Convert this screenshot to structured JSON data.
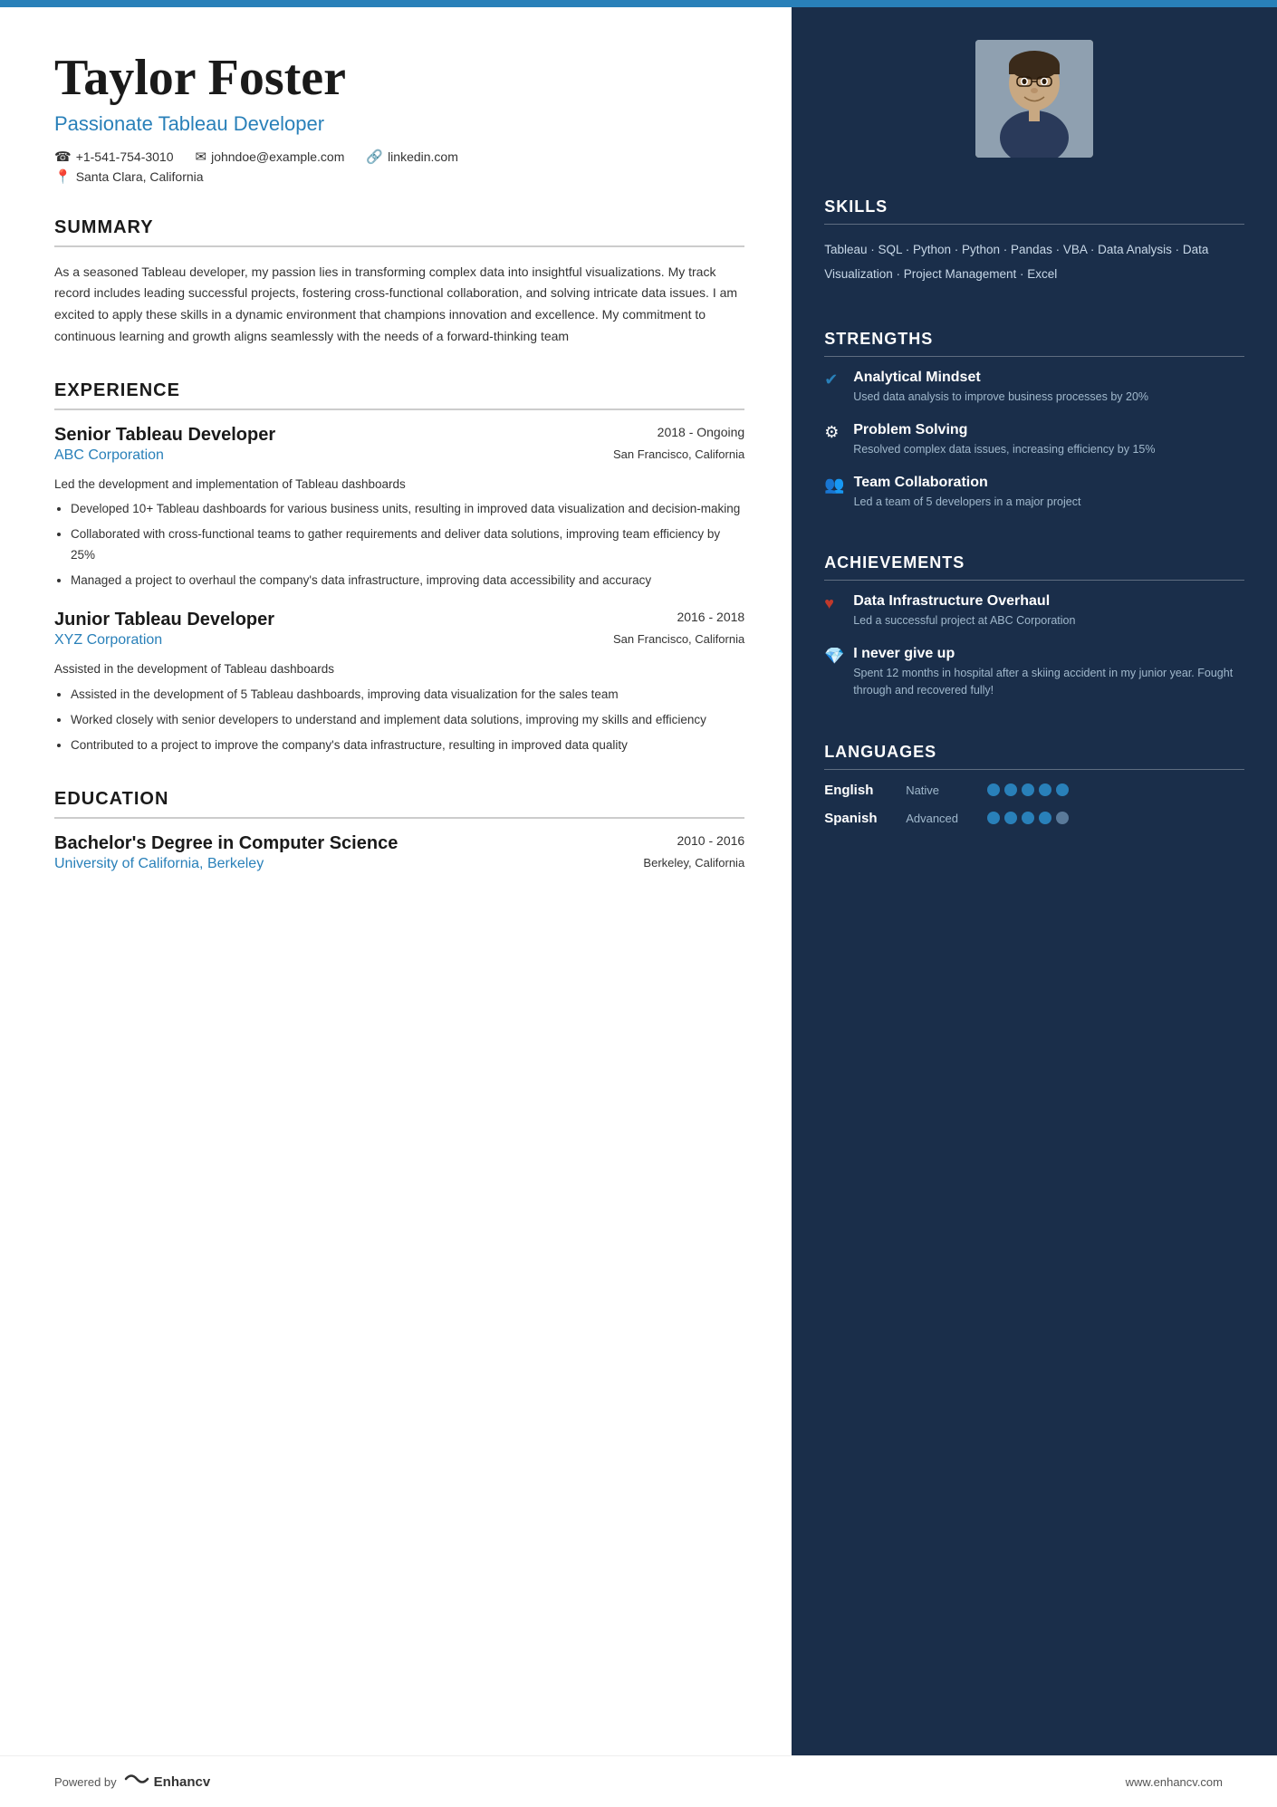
{
  "topbar": {
    "color": "#2980b9"
  },
  "header": {
    "name": "Taylor Foster",
    "title": "Passionate Tableau Developer",
    "phone": "+1-541-754-3010",
    "email": "johndoe@example.com",
    "linkedin": "linkedin.com",
    "location": "Santa Clara, California",
    "phone_icon": "☎",
    "email_icon": "✉",
    "linkedin_icon": "🔗",
    "location_icon": "📍"
  },
  "summary": {
    "title": "SUMMARY",
    "text": "As a seasoned Tableau developer, my passion lies in transforming complex data into insightful visualizations. My track record includes leading successful projects, fostering cross-functional collaboration, and solving intricate data issues. I am excited to apply these skills in a dynamic environment that champions innovation and excellence. My commitment to continuous learning and growth aligns seamlessly with the needs of a forward-thinking team"
  },
  "experience": {
    "title": "EXPERIENCE",
    "entries": [
      {
        "title": "Senior Tableau Developer",
        "company": "ABC Corporation",
        "dates": "2018 - Ongoing",
        "location": "San Francisco, California",
        "description": "Led the development and implementation of Tableau dashboards",
        "bullets": [
          "Developed 10+ Tableau dashboards for various business units, resulting in improved data visualization and decision-making",
          "Collaborated with cross-functional teams to gather requirements and deliver data solutions, improving team efficiency by 25%",
          "Managed a project to overhaul the company's data infrastructure, improving data accessibility and accuracy"
        ]
      },
      {
        "title": "Junior Tableau Developer",
        "company": "XYZ Corporation",
        "dates": "2016 - 2018",
        "location": "San Francisco, California",
        "description": "Assisted in the development of Tableau dashboards",
        "bullets": [
          "Assisted in the development of 5 Tableau dashboards, improving data visualization for the sales team",
          "Worked closely with senior developers to understand and implement data solutions, improving my skills and efficiency",
          "Contributed to a project to improve the company's data infrastructure, resulting in improved data quality"
        ]
      }
    ]
  },
  "education": {
    "title": "EDUCATION",
    "entries": [
      {
        "degree": "Bachelor's Degree in Computer Science",
        "school": "University of California, Berkeley",
        "dates": "2010 - 2016",
        "location": "Berkeley, California"
      }
    ]
  },
  "skills": {
    "title": "SKILLS",
    "text": "Tableau · SQL · Python · Python · Pandas · VBA · Data Analysis · Data Visualization · Project Management · Excel"
  },
  "strengths": {
    "title": "STRENGTHS",
    "items": [
      {
        "icon": "✔",
        "name": "Analytical Mindset",
        "desc": "Used data analysis to improve business processes by 20%"
      },
      {
        "icon": "⚙",
        "name": "Problem Solving",
        "desc": "Resolved complex data issues, increasing efficiency by 15%"
      },
      {
        "icon": "👥",
        "name": "Team Collaboration",
        "desc": "Led a team of 5 developers in a major project"
      }
    ]
  },
  "achievements": {
    "title": "ACHIEVEMENTS",
    "items": [
      {
        "icon": "♥",
        "name": "Data Infrastructure Overhaul",
        "desc": "Led a successful project at ABC Corporation"
      },
      {
        "icon": "💎",
        "name": "I never give up",
        "desc": "Spent 12 months in hospital after a skiing accident in my junior year. Fought through and recovered fully!"
      }
    ]
  },
  "languages": {
    "title": "LANGUAGES",
    "items": [
      {
        "name": "English",
        "level": "Native",
        "filled": 5,
        "empty": 0
      },
      {
        "name": "Spanish",
        "level": "Advanced",
        "filled": 4,
        "empty": 1
      }
    ]
  },
  "footer": {
    "powered_by": "Powered by",
    "brand": "Enhancv",
    "website": "www.enhancv.com"
  }
}
